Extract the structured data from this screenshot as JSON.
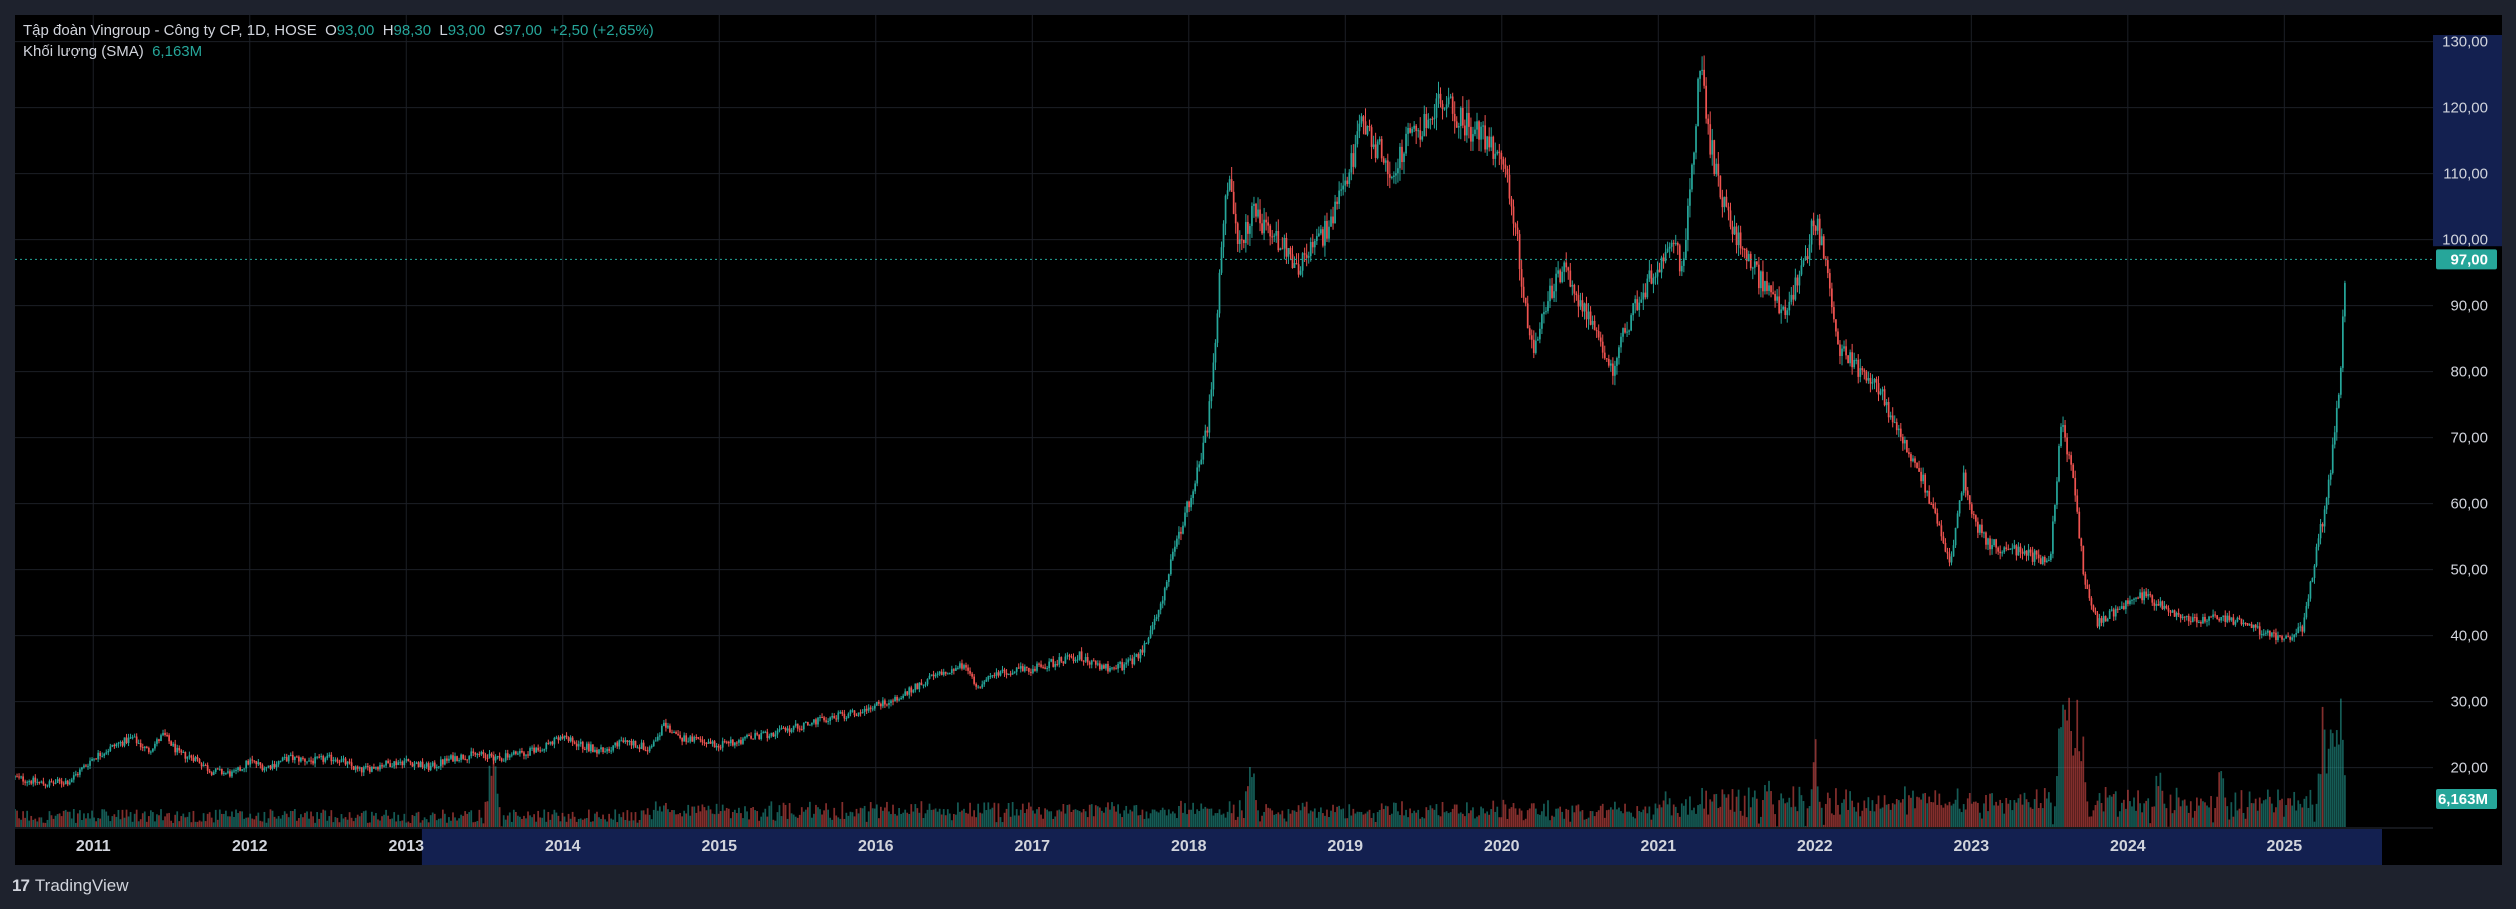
{
  "legend": {
    "symbol": "Tập đoàn Vingroup - Công ty CP, 1D, HOSE",
    "open_key": "O",
    "open": "93,00",
    "high_key": "H",
    "high": "98,30",
    "low_key": "L",
    "low": "93,00",
    "close_key": "C",
    "close": "97,00",
    "change": "+2,50 (+2,65%)",
    "volume_label": "Khối lượng (SMA)",
    "volume_value": "6,163M"
  },
  "brand": {
    "name": "TradingView",
    "icon": "tradingview-logo-icon"
  },
  "colors": {
    "up": "#26a69a",
    "down": "#ef5350",
    "background": "#000000",
    "frame": "#1e222d",
    "grid": "#1c1f26",
    "axis_highlight": "#132050"
  },
  "chart_data": {
    "type": "candlestick",
    "title": "Tập đoàn Vingroup - Công ty CP, 1D, HOSE",
    "x_ticks": [
      "2011",
      "2012",
      "2013",
      "2014",
      "2015",
      "2016",
      "2017",
      "2018",
      "2019",
      "2020",
      "2021",
      "2022",
      "2023",
      "2024",
      "2025"
    ],
    "y_ticks": [
      "20,00",
      "30,00",
      "40,00",
      "50,00",
      "60,00",
      "70,00",
      "80,00",
      "90,00",
      "100,00",
      "110,00",
      "120,00",
      "130,00"
    ],
    "ylim": [
      11,
      131
    ],
    "xlim": [
      2010.5,
      2025.95
    ],
    "last_price": 97.0,
    "last_price_label": "97,00",
    "last_volume_label": "6,163M",
    "price_series": [
      [
        2010.5,
        18.5
      ],
      [
        2010.7,
        17.5
      ],
      [
        2010.85,
        18.0
      ],
      [
        2011.0,
        21.5
      ],
      [
        2011.15,
        23.5
      ],
      [
        2011.25,
        24.5
      ],
      [
        2011.35,
        22.5
      ],
      [
        2011.45,
        25.0
      ],
      [
        2011.55,
        22.0
      ],
      [
        2011.65,
        21.5
      ],
      [
        2011.75,
        19.5
      ],
      [
        2011.9,
        19.0
      ],
      [
        2012.0,
        21.0
      ],
      [
        2012.1,
        20.0
      ],
      [
        2012.25,
        21.5
      ],
      [
        2012.4,
        21.0
      ],
      [
        2012.55,
        21.5
      ],
      [
        2012.7,
        19.5
      ],
      [
        2012.85,
        20.5
      ],
      [
        2013.0,
        21.0
      ],
      [
        2013.15,
        20.0
      ],
      [
        2013.3,
        21.5
      ],
      [
        2013.45,
        22.0
      ],
      [
        2013.6,
        21.5
      ],
      [
        2013.8,
        22.5
      ],
      [
        2014.0,
        24.5
      ],
      [
        2014.1,
        23.5
      ],
      [
        2014.25,
        22.5
      ],
      [
        2014.4,
        24.0
      ],
      [
        2014.55,
        23.0
      ],
      [
        2014.65,
        26.5
      ],
      [
        2014.75,
        24.5
      ],
      [
        2014.9,
        24.0
      ],
      [
        2015.0,
        23.5
      ],
      [
        2015.2,
        24.5
      ],
      [
        2015.4,
        25.5
      ],
      [
        2015.55,
        26.5
      ],
      [
        2015.7,
        27.5
      ],
      [
        2015.9,
        28.5
      ],
      [
        2016.0,
        29.5
      ],
      [
        2016.15,
        30.5
      ],
      [
        2016.3,
        33.0
      ],
      [
        2016.45,
        34.5
      ],
      [
        2016.55,
        35.5
      ],
      [
        2016.65,
        32.5
      ],
      [
        2016.8,
        34.5
      ],
      [
        2017.0,
        35.0
      ],
      [
        2017.15,
        36.0
      ],
      [
        2017.3,
        37.0
      ],
      [
        2017.45,
        35.0
      ],
      [
        2017.6,
        35.5
      ],
      [
        2017.7,
        37.5
      ],
      [
        2017.8,
        43.0
      ],
      [
        2017.9,
        52.0
      ],
      [
        2017.97,
        58.0
      ],
      [
        2018.05,
        64.0
      ],
      [
        2018.12,
        72.0
      ],
      [
        2018.18,
        88.0
      ],
      [
        2018.22,
        103.0
      ],
      [
        2018.26,
        108.0
      ],
      [
        2018.32,
        98.0
      ],
      [
        2018.4,
        104.0
      ],
      [
        2018.5,
        102.0
      ],
      [
        2018.6,
        99.0
      ],
      [
        2018.7,
        96.0
      ],
      [
        2018.8,
        99.0
      ],
      [
        2018.9,
        102.0
      ],
      [
        2019.0,
        108.0
      ],
      [
        2019.1,
        117.0
      ],
      [
        2019.2,
        114.0
      ],
      [
        2019.3,
        110.0
      ],
      [
        2019.4,
        115.0
      ],
      [
        2019.5,
        117.0
      ],
      [
        2019.6,
        121.0
      ],
      [
        2019.7,
        119.0
      ],
      [
        2019.8,
        117.0
      ],
      [
        2019.9,
        115.0
      ],
      [
        2020.0,
        113.0
      ],
      [
        2020.08,
        103.0
      ],
      [
        2020.15,
        90.0
      ],
      [
        2020.2,
        82.0
      ],
      [
        2020.3,
        92.0
      ],
      [
        2020.4,
        95.0
      ],
      [
        2020.5,
        91.0
      ],
      [
        2020.6,
        85.0
      ],
      [
        2020.7,
        80.0
      ],
      [
        2020.8,
        87.0
      ],
      [
        2020.9,
        92.0
      ],
      [
        2021.0,
        96.0
      ],
      [
        2021.1,
        100.0
      ],
      [
        2021.15,
        95.0
      ],
      [
        2021.22,
        112.0
      ],
      [
        2021.27,
        127.0
      ],
      [
        2021.32,
        116.0
      ],
      [
        2021.4,
        107.0
      ],
      [
        2021.5,
        100.0
      ],
      [
        2021.6,
        96.0
      ],
      [
        2021.7,
        92.0
      ],
      [
        2021.8,
        89.0
      ],
      [
        2021.9,
        94.0
      ],
      [
        2022.0,
        103.0
      ],
      [
        2022.08,
        96.0
      ],
      [
        2022.15,
        84.0
      ],
      [
        2022.25,
        81.0
      ],
      [
        2022.4,
        78.0
      ],
      [
        2022.55,
        70.0
      ],
      [
        2022.7,
        63.0
      ],
      [
        2022.8,
        56.0
      ],
      [
        2022.87,
        51.0
      ],
      [
        2022.95,
        64.0
      ],
      [
        2023.0,
        58.0
      ],
      [
        2023.1,
        54.0
      ],
      [
        2023.25,
        53.0
      ],
      [
        2023.4,
        52.0
      ],
      [
        2023.5,
        51.0
      ],
      [
        2023.58,
        73.0
      ],
      [
        2023.66,
        62.0
      ],
      [
        2023.72,
        49.0
      ],
      [
        2023.8,
        42.0
      ],
      [
        2024.0,
        45.0
      ],
      [
        2024.1,
        46.0
      ],
      [
        2024.2,
        45.0
      ],
      [
        2024.3,
        43.0
      ],
      [
        2024.4,
        42.0
      ],
      [
        2024.6,
        43.0
      ],
      [
        2024.8,
        41.0
      ],
      [
        2024.95,
        40.0
      ],
      [
        2025.05,
        40.0
      ],
      [
        2025.12,
        41.0
      ],
      [
        2025.2,
        52.0
      ],
      [
        2025.28,
        62.0
      ],
      [
        2025.33,
        72.0
      ],
      [
        2025.36,
        80.0
      ],
      [
        2025.38,
        90.0
      ],
      [
        2025.4,
        97.0
      ]
    ],
    "volume_spikes": [
      [
        2013.55,
        0.55
      ],
      [
        2018.4,
        0.45
      ],
      [
        2021.7,
        0.42
      ],
      [
        2022.0,
        0.5
      ],
      [
        2023.58,
        0.95
      ],
      [
        2023.62,
        0.85
      ],
      [
        2023.66,
        0.9
      ],
      [
        2023.7,
        0.7
      ],
      [
        2024.2,
        0.45
      ],
      [
        2024.6,
        0.4
      ],
      [
        2025.25,
        0.75
      ],
      [
        2025.3,
        0.65
      ],
      [
        2025.36,
        0.9
      ]
    ]
  }
}
